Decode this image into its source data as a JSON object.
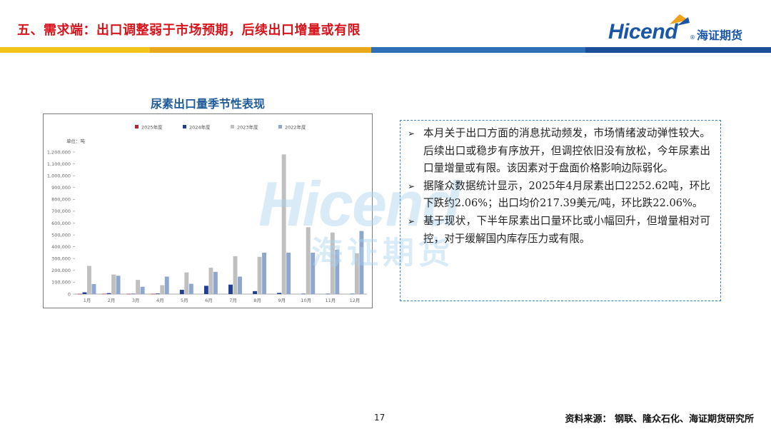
{
  "header": {
    "title": "五、需求端：出口调整弱于市场预期，后续出口增量或有限",
    "logo_word": "Hicend",
    "logo_reg": "®",
    "logo_cn": "海证期货"
  },
  "band_colors": [
    "#f0c419",
    "#e9a91a",
    "#e9a91a",
    "#2e6fb7",
    "#1b4f9a"
  ],
  "watermark": {
    "word": "Hicend",
    "cn": "海证期货"
  },
  "chart_data": {
    "type": "bar",
    "title": "尿素出口量季节性表现",
    "unit_label": "单位：吨",
    "categories": [
      "1月",
      "2月",
      "3月",
      "4月",
      "5月",
      "6月",
      "7月",
      "8月",
      "9月",
      "10月",
      "11月",
      "12月"
    ],
    "ylim": [
      0,
      1200000
    ],
    "ytick_values": [
      0,
      100000,
      200000,
      300000,
      400000,
      500000,
      600000,
      700000,
      800000,
      900000,
      1000000,
      1100000,
      1200000
    ],
    "ytick_labels": [
      "0",
      "100,000",
      "200,000",
      "300,000",
      "400,000",
      "500,000",
      "600,000",
      "700,000",
      "800,000",
      "900,000",
      "1,000,000",
      "1,100,000",
      "1,200,000"
    ],
    "legend_position": "top-center",
    "grid": false,
    "series": [
      {
        "name": "2025年度",
        "color": "#c0202a",
        "values": [
          2000,
          3000,
          2000,
          2253,
          null,
          null,
          null,
          null,
          null,
          null,
          null,
          null
        ]
      },
      {
        "name": "2024年度",
        "color": "#1f3f8f",
        "values": [
          15000,
          8000,
          3000,
          5000,
          36000,
          70000,
          80000,
          25000,
          10000,
          3000,
          3000,
          3000
        ]
      },
      {
        "name": "2023年度",
        "color": "#bfbfbf",
        "values": [
          238000,
          165000,
          120000,
          75000,
          183000,
          223000,
          320000,
          315000,
          1180000,
          565000,
          520000,
          345000
        ]
      },
      {
        "name": "2022年度",
        "color": "#8ea7cf",
        "values": [
          85000,
          155000,
          62000,
          148000,
          87000,
          188000,
          148000,
          350000,
          350000,
          350000,
          375000,
          533000
        ]
      }
    ]
  },
  "textbox": {
    "bullets": [
      "本月关于出口方面的消息扰动频发，市场情绪波动弹性较大。后续出口或稳步有序放开，但调控依旧没有放松，今年尿素出口量增量或有限。该因素对于盘面价格影响边际弱化。",
      "据隆众数据统计显示，2025年4月尿素出口2252.62吨，环比下跌约2.06%；出口均价217.39美元/吨，环比跌22.06%。",
      "基于现状，下半年尿素出口量环比或小幅回升，但增量相对可控，对于缓解国内库存压力或有限。"
    ]
  },
  "footer": {
    "page_number": "17",
    "source": "资料来源：  钢联、隆众石化、海证期货研究所"
  }
}
